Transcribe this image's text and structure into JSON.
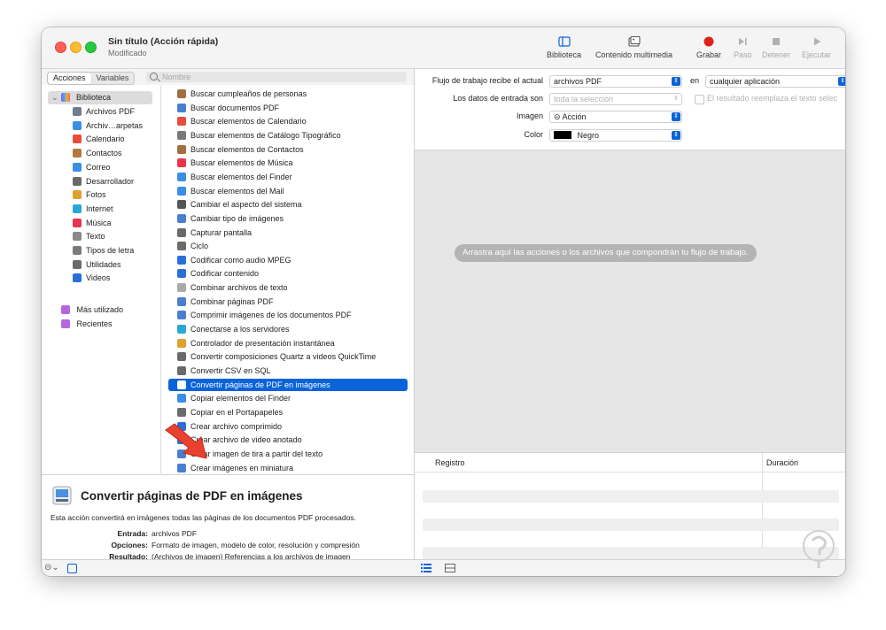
{
  "window": {
    "title": "Sin título (Acción rápida)",
    "subtitle": "Modificado"
  },
  "toolbar": {
    "library": "Biblioteca",
    "media": "Contenido multimedia",
    "record": "Grabar",
    "step": "Paso",
    "stop": "Detener",
    "run": "Ejecutar"
  },
  "tabs": {
    "actions": "Acciones",
    "variables": "Variables"
  },
  "search": {
    "placeholder": "Nombre"
  },
  "library": {
    "header": "Biblioteca",
    "items": [
      "Archivos PDF",
      "Archiv…arpetas",
      "Calendario",
      "Contactos",
      "Correo",
      "Desarrollador",
      "Fotos",
      "Internet",
      "Música",
      "Texto",
      "Tipos de letra",
      "Utilidades",
      "Videos"
    ],
    "most_used": "Más utilizado",
    "recent": "Recientes"
  },
  "actions": [
    "Buscar cumpleaños de personas",
    "Buscar documentos PDF",
    "Buscar elementos de Calendario",
    "Buscar elementos de Catálogo Tipográfico",
    "Buscar elementos de Contactos",
    "Buscar elementos de Música",
    "Buscar elementos del Finder",
    "Buscar elementos del Mail",
    "Cambiar el aspecto del sistema",
    "Cambiar tipo de imágenes",
    "Capturar pantalla",
    "Ciclo",
    "Codificar como audio MPEG",
    "Codificar contenido",
    "Combinar archivos de texto",
    "Combinar páginas PDF",
    "Comprimir imágenes de los documentos PDF",
    "Conectarse a los servidores",
    "Controlador de presentación instantánea",
    "Convertir composiciones Quartz a videos QuickTime",
    "Convertir CSV en SQL",
    "Convertir páginas de PDF en imágenes",
    "Copiar elementos del Finder",
    "Copiar en el Portapapeles",
    "Crear archivo comprimido",
    "Crear archivo de video anotado",
    "Crear imagen de tira a partir del texto",
    "Crear imágenes en miniatura"
  ],
  "selected_action_index": 21,
  "description": {
    "title": "Convertir páginas de PDF en imágenes",
    "body": "Esta acción convertirá en imágenes todas las páginas de los documentos PDF procesados.",
    "input_label": "Entrada:",
    "input_value": "archivos PDF",
    "options_label": "Opciones:",
    "options_value": "Formato de imagen, modelo de color, resolución y compresión",
    "result_label": "Resultado:",
    "result_value": "(Archivos de imagen) Referencias a los archivos de imagen"
  },
  "workflow": {
    "receives_label": "Flujo de trabajo recibe el actual",
    "receives_value": "archivos PDF",
    "in_label": "en",
    "in_value": "cualquier aplicación",
    "input_is_label": "Los datos de entrada son",
    "input_is_value": "toda la selección",
    "replace_label": "El resultado reemplaza el texto selec",
    "image_label": "Imagen",
    "image_value": "⊝ Acción",
    "color_label": "Color",
    "color_value": "Negro",
    "drop_hint": "Arrastra aquí las acciones o los archivos que compondrán tu flujo de trabajo."
  },
  "log": {
    "col_log": "Registro",
    "col_duration": "Duración"
  },
  "colors": {
    "accent": "#0a63d9",
    "record": "#e0201c"
  }
}
